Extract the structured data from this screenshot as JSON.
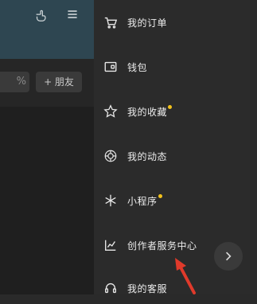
{
  "header": {
    "hand_icon": "hand-pointer-icon",
    "menu_icon": "hamburger-menu-icon"
  },
  "main": {
    "search_stub": "%",
    "add_friend_label": "+ 朋友"
  },
  "drawer": {
    "items": [
      {
        "label": "我的订单",
        "icon": "cart-icon",
        "dot": false
      },
      {
        "label": "钱包",
        "icon": "wallet-icon",
        "dot": false
      },
      {
        "label": "我的收藏",
        "icon": "star-icon",
        "dot": true
      },
      {
        "label": "我的动态",
        "icon": "moments-icon",
        "dot": false
      },
      {
        "label": "小程序",
        "icon": "mini-program-icon",
        "dot": true
      },
      {
        "label": "创作者服务中心",
        "icon": "chart-icon",
        "dot": false
      },
      {
        "label": "我的客服",
        "icon": "headset-icon",
        "dot": false
      }
    ]
  },
  "colors": {
    "dot": "#f3c21b",
    "annotation_arrow": "#e03a2b"
  }
}
